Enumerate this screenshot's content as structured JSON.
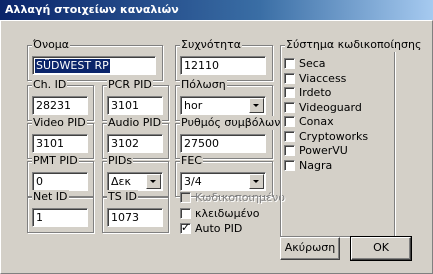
{
  "window": {
    "title": "Αλλαγή στοιχείων καναλιών"
  },
  "fields": {
    "name": {
      "label": "Όνομα",
      "value": "SÜDWEST RP"
    },
    "frequency": {
      "label": "Συχνότητα",
      "value": "12110"
    },
    "ch_id": {
      "label": "Ch. ID",
      "value": "28231"
    },
    "pcr_pid": {
      "label": "PCR PID",
      "value": "3101"
    },
    "polarization": {
      "label": "Πόλωση",
      "value": "hor"
    },
    "video_pid": {
      "label": "Video PID",
      "value": "3101"
    },
    "audio_pid": {
      "label": "Audio PID",
      "value": "3102"
    },
    "symbol_rate": {
      "label": "Ρυθμός συμβόλων",
      "value": "27500"
    },
    "pmt_pid": {
      "label": "PMT PID",
      "value": "0"
    },
    "pids": {
      "label": "PIDs",
      "value": "Δεκ"
    },
    "fec": {
      "label": "FEC",
      "value": "3/4"
    },
    "net_id": {
      "label": "Net ID",
      "value": "1"
    },
    "ts_id": {
      "label": "TS ID",
      "value": "1073"
    }
  },
  "options": {
    "encrypted": {
      "label": "Κωδικοποιημένο",
      "checked": false,
      "disabled": true
    },
    "locked": {
      "label": "κλειδωμένο",
      "checked": false
    },
    "auto_pid": {
      "label": "Auto PID",
      "checked": true
    }
  },
  "encryption": {
    "label": "Σύστημα κωδικοποίησης",
    "systems": [
      {
        "label": "Seca",
        "checked": false
      },
      {
        "label": "Viaccess",
        "checked": false
      },
      {
        "label": "Irdeto",
        "checked": false
      },
      {
        "label": "Videoguard",
        "checked": false
      },
      {
        "label": "Conax",
        "checked": false
      },
      {
        "label": "Cryptoworks",
        "checked": false
      },
      {
        "label": "PowerVU",
        "checked": false
      },
      {
        "label": "Nagra",
        "checked": false
      }
    ]
  },
  "buttons": {
    "cancel": "Ακύρωση",
    "ok": "OK"
  }
}
